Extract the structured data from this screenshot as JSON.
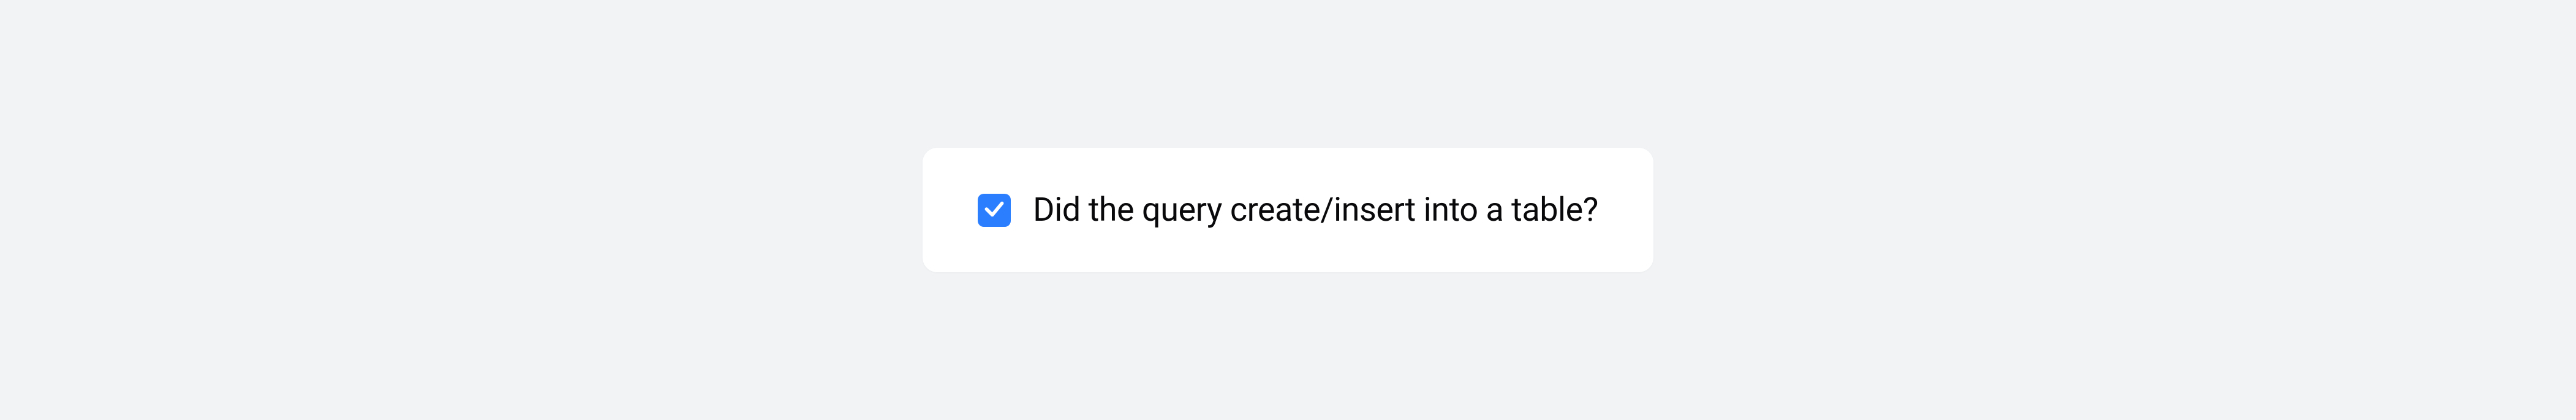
{
  "checkbox": {
    "checked": true,
    "label": "Did the query create/insert into a table?"
  }
}
